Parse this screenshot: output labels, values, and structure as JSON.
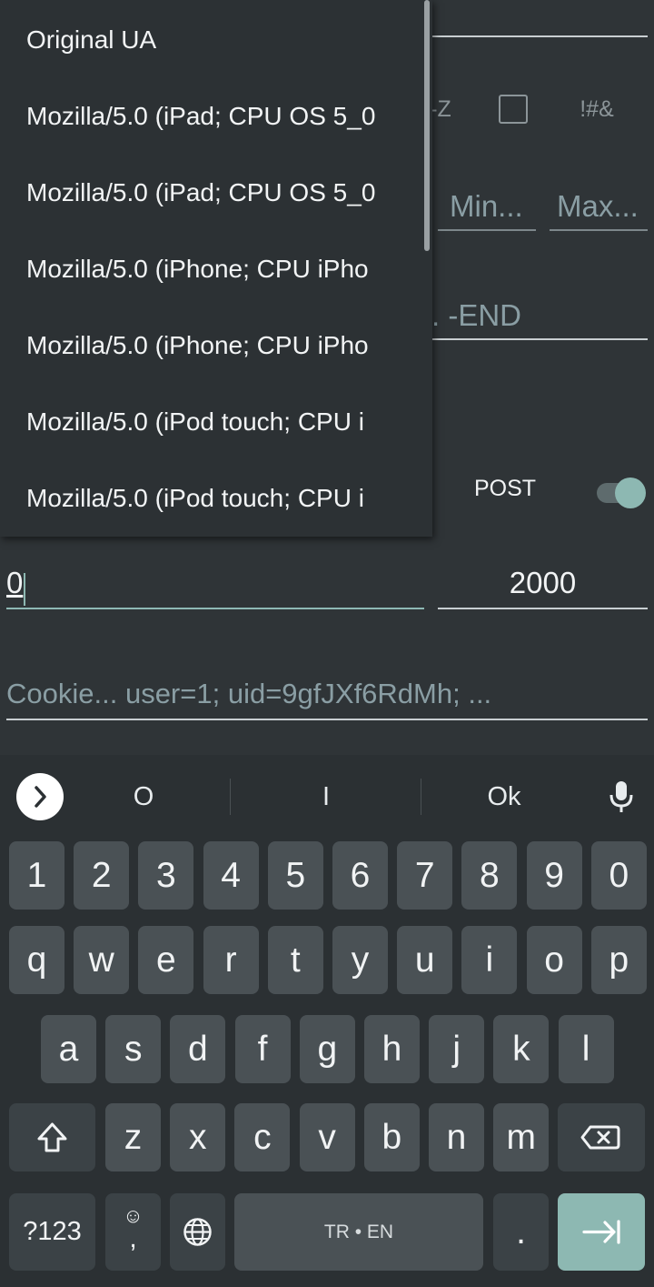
{
  "form": {
    "az_label": "-Z",
    "symbols_label": "!#&",
    "min_hint": "Min...",
    "max_hint": "Max...",
    "end_hint": ". -END",
    "post_label": "POST",
    "post_enabled": true,
    "start_value": "0",
    "end_value": "2000",
    "cookie_hint": "Cookie... user=1; uid=9gfJXf6RdMh; ..."
  },
  "dropdown": {
    "items": [
      "Original UA",
      "Mozilla/5.0 (iPad; CPU OS 5_0",
      "Mozilla/5.0 (iPad; CPU OS 5_0",
      "Mozilla/5.0 (iPhone; CPU iPho",
      "Mozilla/5.0 (iPhone; CPU iPho",
      "Mozilla/5.0 (iPod touch; CPU i",
      "Mozilla/5.0 (iPod touch; CPU i"
    ]
  },
  "keyboard": {
    "suggestions": [
      "O",
      "I",
      "Ok"
    ],
    "number_row": [
      "1",
      "2",
      "3",
      "4",
      "5",
      "6",
      "7",
      "8",
      "9",
      "0"
    ],
    "row1": [
      "q",
      "w",
      "e",
      "r",
      "t",
      "y",
      "u",
      "i",
      "o",
      "p"
    ],
    "row2": [
      "a",
      "s",
      "d",
      "f",
      "g",
      "h",
      "j",
      "k",
      "l"
    ],
    "row3": [
      "z",
      "x",
      "c",
      "v",
      "b",
      "n",
      "m"
    ],
    "symbols_key": "?123",
    "comma_key": ",",
    "emoji_glyph": "☺",
    "space_label": "TR • EN",
    "period_key": ".",
    "shift_icon": "shift-icon",
    "backspace_icon": "backspace-icon",
    "globe_icon": "globe-icon",
    "enter_icon": "tab-enter-icon"
  }
}
